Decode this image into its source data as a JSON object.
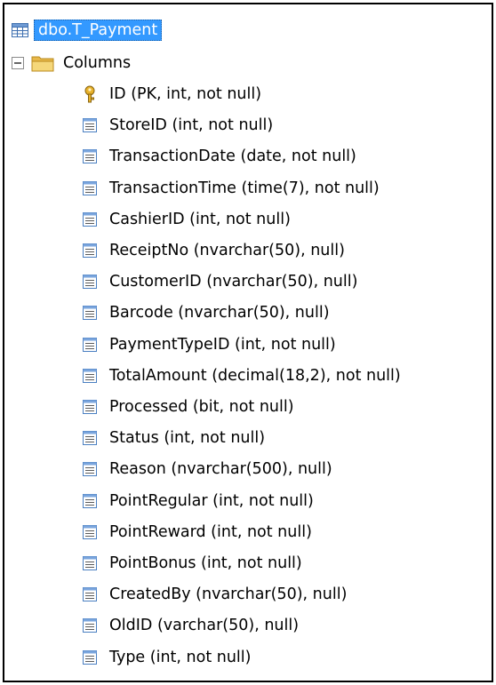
{
  "tree": {
    "root_label": "dbo.T_Payment",
    "columns_folder_label": "Columns",
    "columns": [
      {
        "label": "ID (PK, int, not null)",
        "icon": "key-icon"
      },
      {
        "label": "StoreID (int, not null)",
        "icon": "column-icon"
      },
      {
        "label": "TransactionDate (date, not null)",
        "icon": "column-icon"
      },
      {
        "label": "TransactionTime (time(7), not null)",
        "icon": "column-icon"
      },
      {
        "label": "CashierID (int, not null)",
        "icon": "column-icon"
      },
      {
        "label": "ReceiptNo (nvarchar(50), null)",
        "icon": "column-icon"
      },
      {
        "label": "CustomerID (nvarchar(50), null)",
        "icon": "column-icon"
      },
      {
        "label": "Barcode (nvarchar(50), null)",
        "icon": "column-icon"
      },
      {
        "label": "PaymentTypeID (int, not null)",
        "icon": "column-icon"
      },
      {
        "label": "TotalAmount (decimal(18,2), not null)",
        "icon": "column-icon"
      },
      {
        "label": "Processed (bit, not null)",
        "icon": "column-icon"
      },
      {
        "label": "Status (int, not null)",
        "icon": "column-icon"
      },
      {
        "label": "Reason (nvarchar(500), null)",
        "icon": "column-icon"
      },
      {
        "label": "PointRegular (int, not null)",
        "icon": "column-icon"
      },
      {
        "label": "PointReward (int, not null)",
        "icon": "column-icon"
      },
      {
        "label": "PointBonus (int, not null)",
        "icon": "column-icon"
      },
      {
        "label": "CreatedBy (nvarchar(50), null)",
        "icon": "column-icon"
      },
      {
        "label": "OldID (varchar(50), null)",
        "icon": "column-icon"
      },
      {
        "label": "Type (int, not null)",
        "icon": "column-icon"
      }
    ]
  },
  "colors": {
    "selection": "#3399ff",
    "key": "#e8b22c",
    "column_icon": "#4a7fc1",
    "folder": "#f2cc5c"
  }
}
